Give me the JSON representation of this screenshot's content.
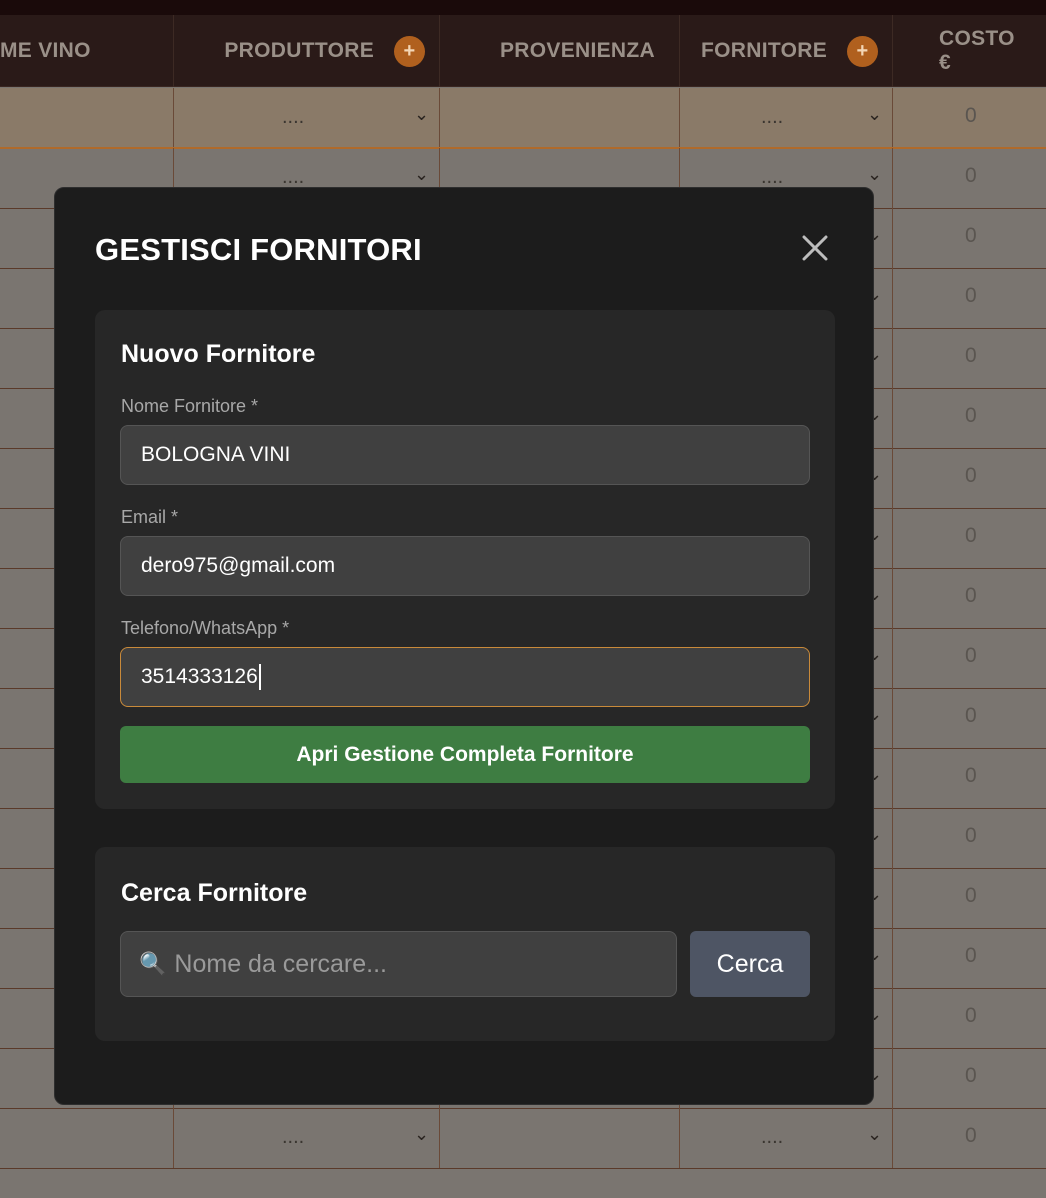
{
  "table": {
    "headers": [
      {
        "label": "ME VINO",
        "has_add": false
      },
      {
        "label": "PRODUTTORE",
        "has_add": true
      },
      {
        "label": "PROVENIENZA",
        "has_add": false
      },
      {
        "label": "FORNITORE",
        "has_add": true
      },
      {
        "label": "COSTO €",
        "has_add": false
      }
    ],
    "add_symbol": "+",
    "placeholder_select": "....",
    "cost_value": "0",
    "row_count": 18
  },
  "modal": {
    "title": "GESTISCI FORNITORI",
    "close_icon": "close-icon",
    "new_supplier": {
      "title": "Nuovo Fornitore",
      "name_label": "Nome Fornitore *",
      "name_value": "BOLOGNA VINI",
      "email_label": "Email *",
      "email_value": "dero975@gmail.com",
      "phone_label": "Telefono/WhatsApp *",
      "phone_value": "3514333126",
      "open_button": "Apri Gestione Completa Fornitore"
    },
    "search_supplier": {
      "title": "Cerca Fornitore",
      "search_icon": "🔍",
      "placeholder": "Nome da cercare...",
      "search_button": "Cerca"
    }
  },
  "colors": {
    "accent_orange": "#b0601e",
    "green_button": "#3e7d42",
    "focus_border": "#c98a3a"
  }
}
